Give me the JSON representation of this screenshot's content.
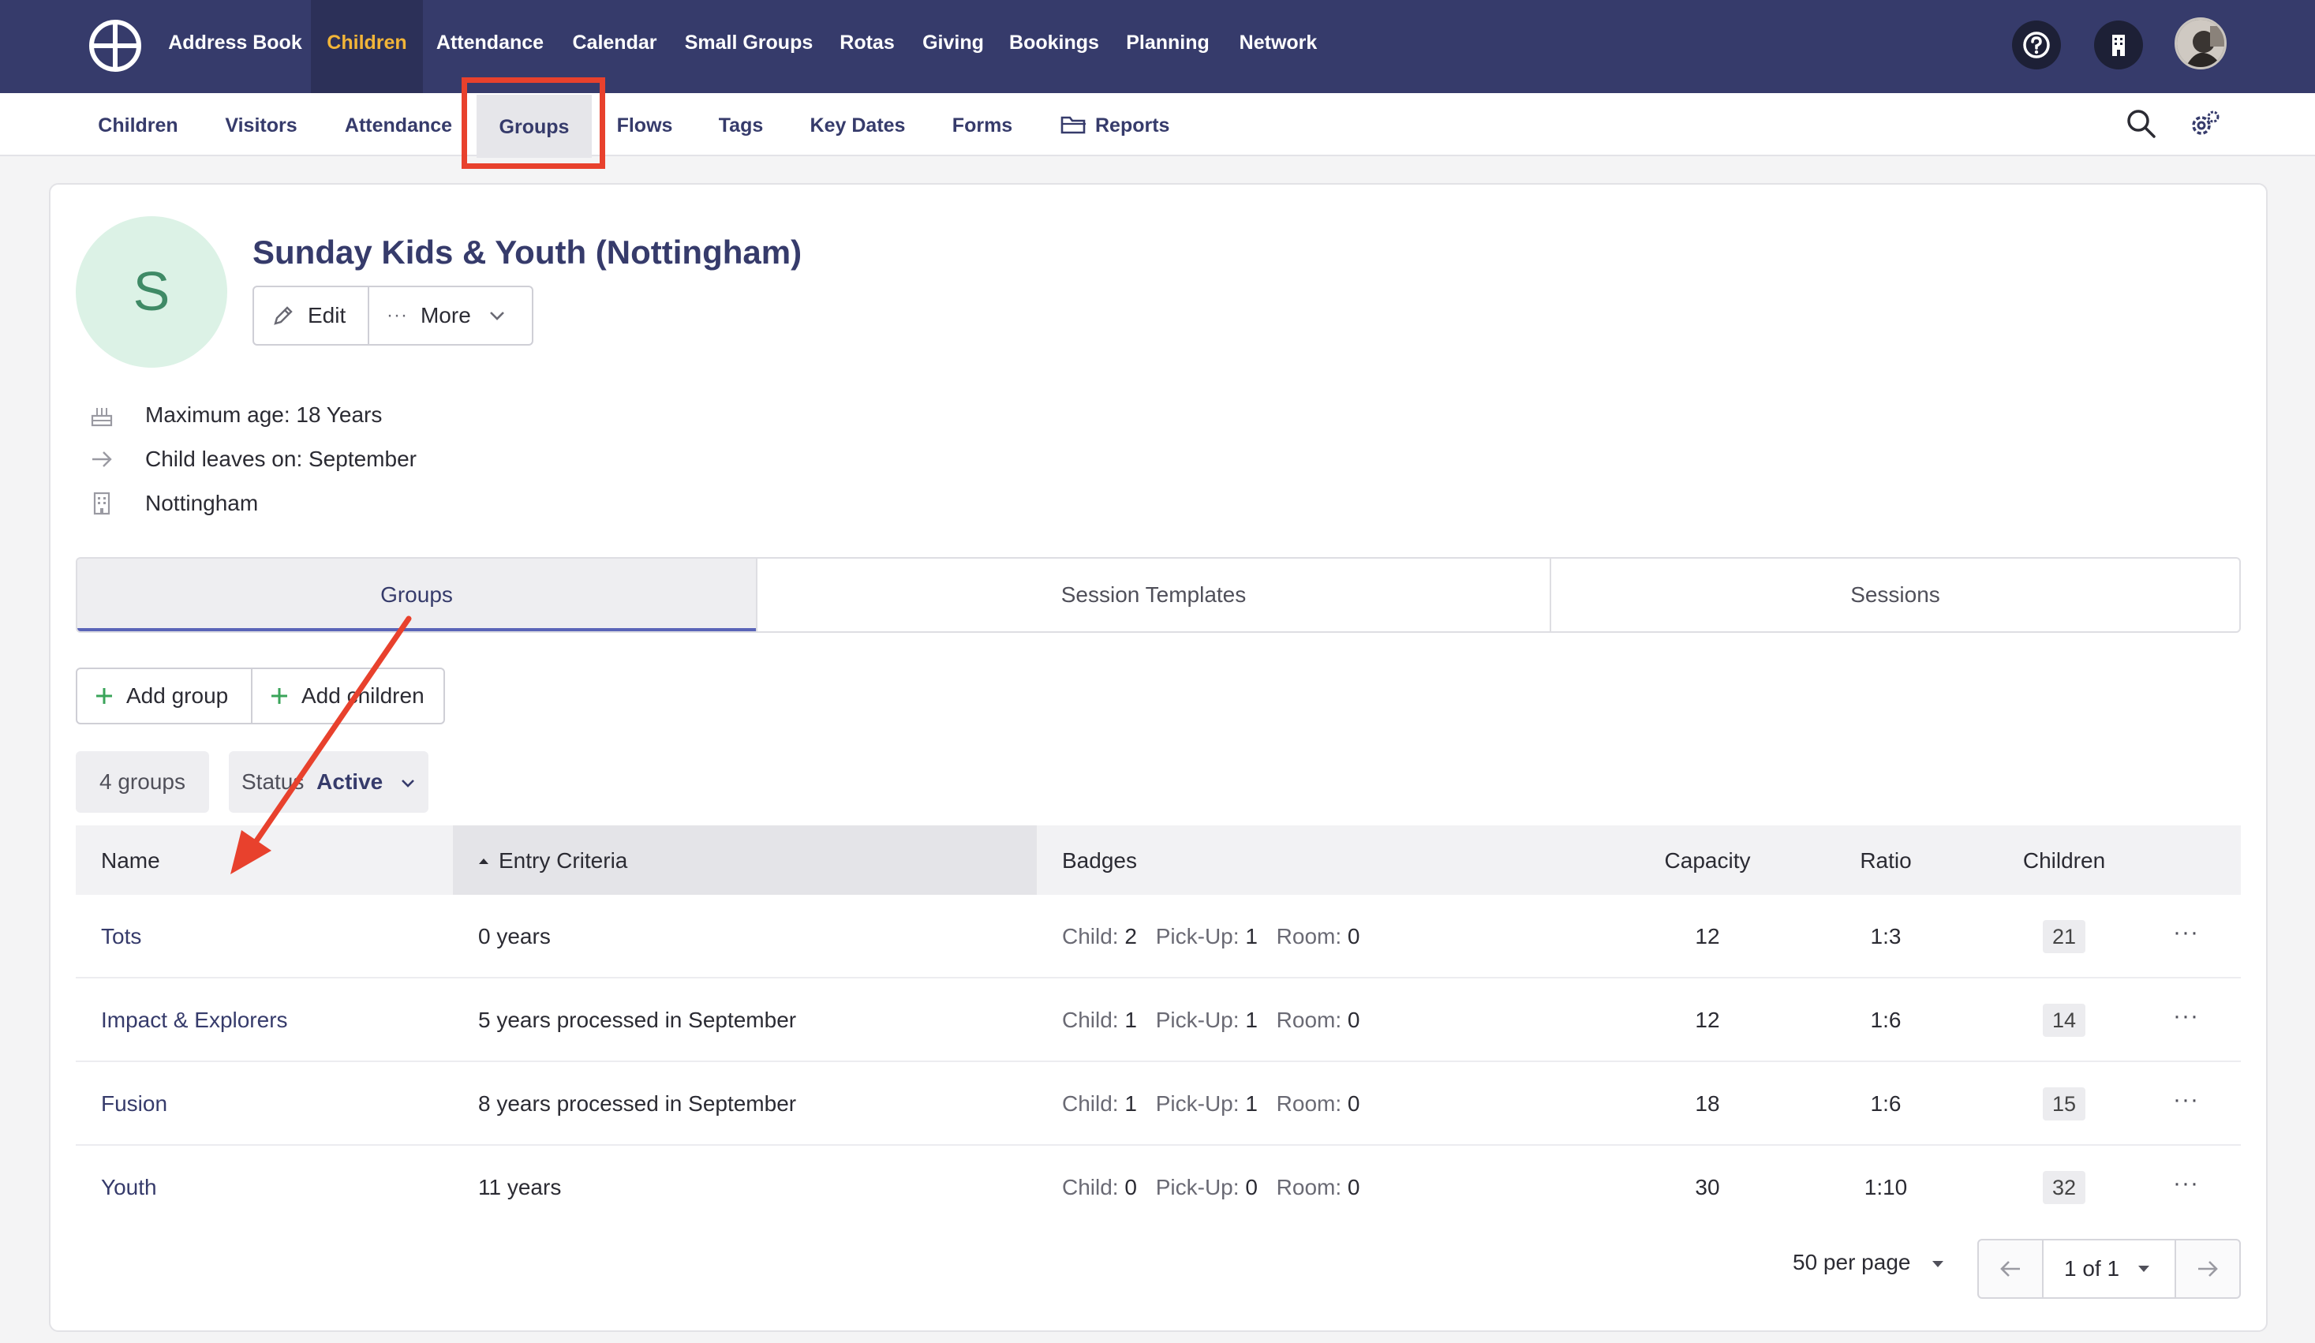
{
  "topnav": {
    "items": [
      "Address Book",
      "Children",
      "Attendance",
      "Calendar",
      "Small Groups",
      "Rotas",
      "Giving",
      "Bookings",
      "Planning",
      "Network"
    ],
    "active": "Children",
    "icons": [
      "help-icon",
      "building-icon",
      "avatar"
    ]
  },
  "subnav": {
    "items": [
      "Children",
      "Visitors",
      "Attendance",
      "Groups",
      "Flows",
      "Tags",
      "Key Dates",
      "Forms",
      "Reports"
    ],
    "active": "Groups",
    "icons": [
      "search-icon",
      "settings-gear-icon"
    ]
  },
  "group": {
    "initial": "S",
    "title": "Sunday Kids & Youth (Nottingham)",
    "edit_label": "Edit",
    "more_label": "More",
    "info": {
      "max_age": "Maximum age: 18 Years",
      "leaves": "Child leaves on: September",
      "location": "Nottingham"
    }
  },
  "tabs": [
    "Groups",
    "Session Templates",
    "Sessions"
  ],
  "actions": {
    "add_group": "Add group",
    "add_children": "Add children"
  },
  "filters": {
    "count": "4 groups",
    "status_label": "Status",
    "status_value": "Active"
  },
  "table": {
    "headers": [
      "Name",
      "Entry Criteria",
      "Badges",
      "Capacity",
      "Ratio",
      "Children"
    ],
    "badge_labels": [
      "Child:",
      "Pick-Up:",
      "Room:"
    ],
    "rows": [
      {
        "name": "Tots",
        "criteria": "0 years",
        "child": "2",
        "pickup": "1",
        "room": "0",
        "capacity": "12",
        "ratio": "1:3",
        "children": "21"
      },
      {
        "name": "Impact & Explorers",
        "criteria": "5 years processed in September",
        "child": "1",
        "pickup": "1",
        "room": "0",
        "capacity": "12",
        "ratio": "1:6",
        "children": "14"
      },
      {
        "name": "Fusion",
        "criteria": "8 years processed in September",
        "child": "1",
        "pickup": "1",
        "room": "0",
        "capacity": "18",
        "ratio": "1:6",
        "children": "15"
      },
      {
        "name": "Youth",
        "criteria": "11 years",
        "child": "0",
        "pickup": "0",
        "room": "0",
        "capacity": "30",
        "ratio": "1:10",
        "children": "32"
      }
    ]
  },
  "pagination": {
    "per_page": "50 per page",
    "page": "1 of 1"
  },
  "colors": {
    "nav_bg": "#363b6b",
    "active_nav": "#f2b538",
    "highlight": "#e8412d"
  }
}
